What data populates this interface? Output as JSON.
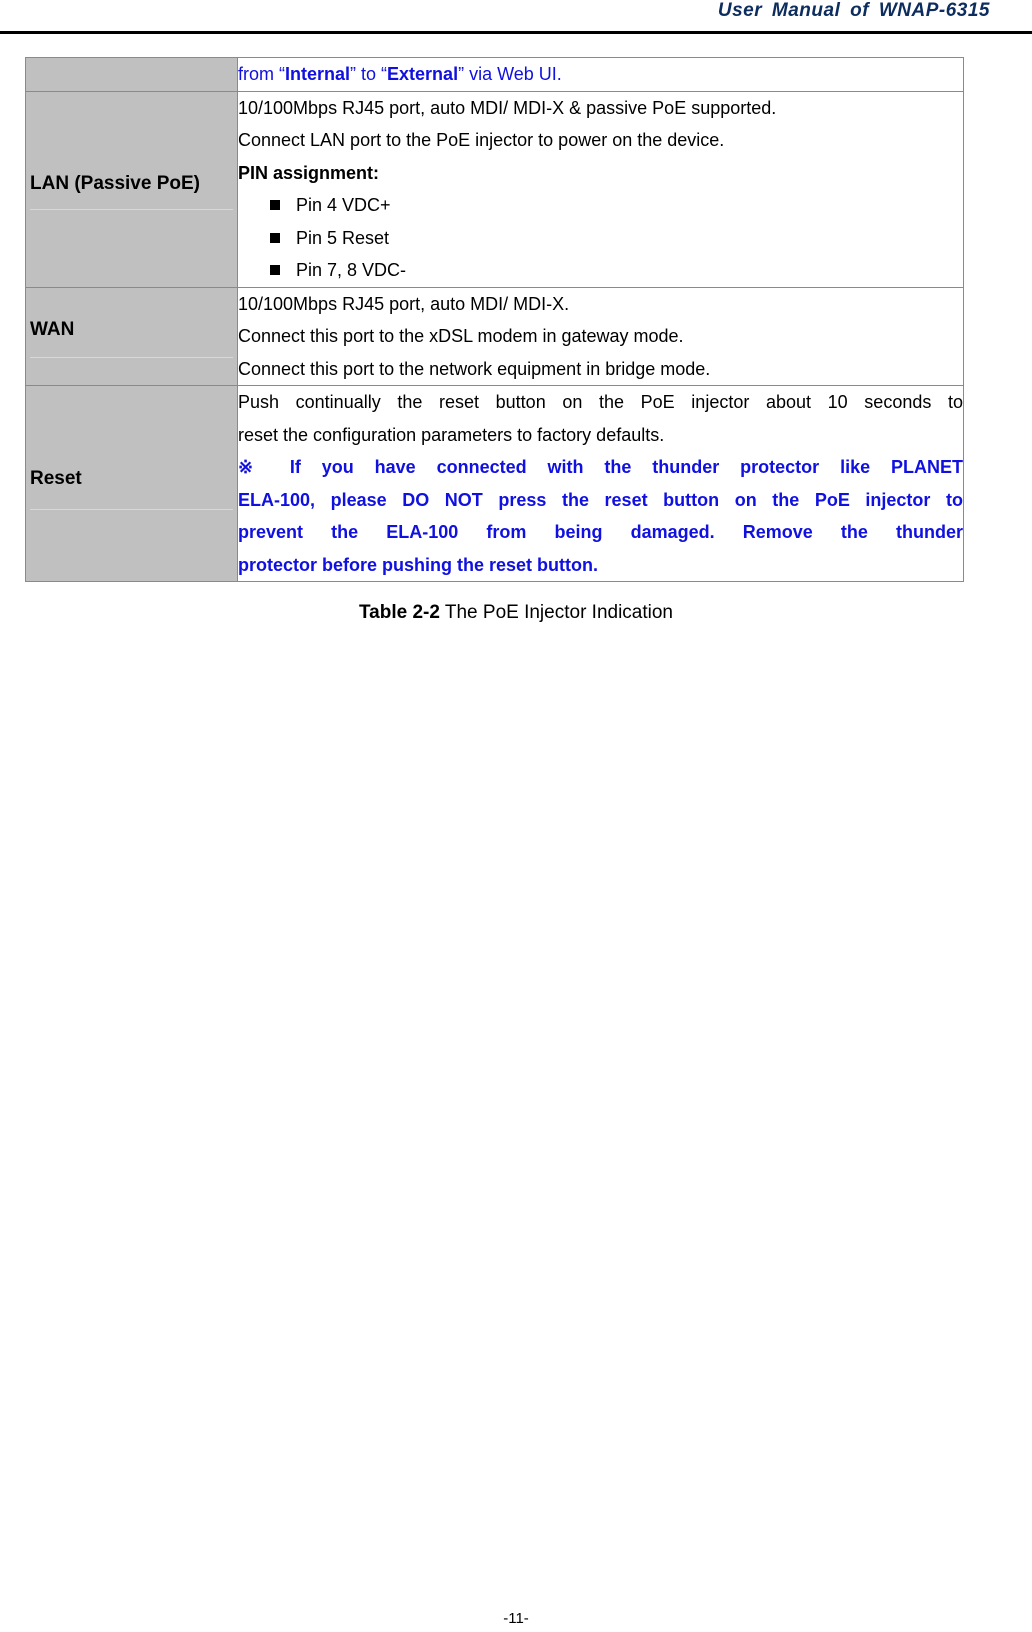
{
  "header": {
    "title": "User  Manual  of  WNAP-6315"
  },
  "table": {
    "rows": [
      {
        "label": "",
        "continuation": {
          "pre": "from “",
          "b1": "Internal",
          "mid": "” to “",
          "b2": "External",
          "post": "” via Web UI."
        }
      },
      {
        "label": "LAN (Passive PoE)",
        "lines": [
          "10/100Mbps RJ45 port, auto MDI/ MDI-X & passive PoE supported.",
          "Connect LAN port to the PoE injector to power on the device."
        ],
        "subheading": "PIN assignment:",
        "bullets": [
          "Pin 4 VDC+",
          "Pin 5 Reset",
          "Pin 7, 8 VDC-"
        ]
      },
      {
        "label": "WAN",
        "lines": [
          "10/100Mbps RJ45 port, auto MDI/ MDI-X.",
          "Connect this port to the xDSL modem in gateway mode.",
          "Connect this port to the network equipment in bridge mode."
        ]
      },
      {
        "label": "Reset",
        "lines": [
          "Push continually the reset button on the PoE injector about 10 seconds to",
          "reset the configuration parameters to factory defaults."
        ],
        "warning": [
          "※ If you have connected with the thunder protector like PLANET",
          "ELA-100, please DO NOT press the reset button on the PoE injector to",
          "prevent the ELA-100 from being damaged. Remove the thunder",
          "protector before pushing the reset button."
        ]
      }
    ]
  },
  "caption": {
    "bold": "Table 2-2",
    "text": " The PoE Injector Indication"
  },
  "footer": {
    "page_number": "-11-"
  },
  "colors": {
    "header_text": "#0d2d5e",
    "label_bg": "#c0c0c0",
    "warning_text": "#1010e0"
  }
}
